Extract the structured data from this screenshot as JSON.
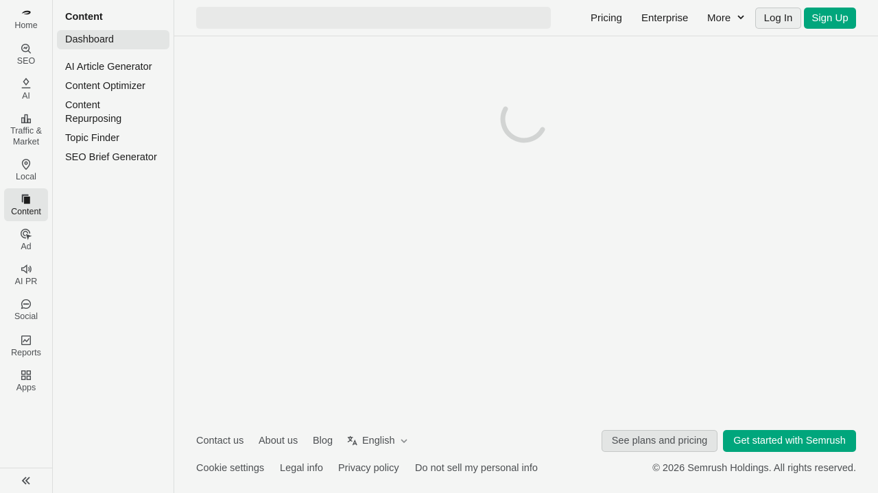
{
  "rail": {
    "items": [
      {
        "label": "Home",
        "icon": "semrush-logo-icon"
      },
      {
        "label": "SEO",
        "icon": "seo-magnifier-icon"
      },
      {
        "label": "AI",
        "icon": "ai-sparkle-icon"
      },
      {
        "label": "Traffic & Market",
        "icon": "bar-chart-icon"
      },
      {
        "label": "Local",
        "icon": "map-pin-icon"
      },
      {
        "label": "Content",
        "icon": "documents-icon"
      },
      {
        "label": "Ad",
        "icon": "ad-target-icon"
      },
      {
        "label": "AI PR",
        "icon": "megaphone-icon"
      },
      {
        "label": "Social",
        "icon": "chat-bubble-icon"
      },
      {
        "label": "Reports",
        "icon": "report-chart-icon"
      },
      {
        "label": "Apps",
        "icon": "apps-grid-icon"
      }
    ],
    "active": "Content",
    "collapse_icon": "double-chevron-left-icon"
  },
  "subnav": {
    "title": "Content",
    "items": [
      {
        "label": "Dashboard"
      },
      {
        "label": "AI Article Generator"
      },
      {
        "label": "Content Optimizer"
      },
      {
        "label": "Content Repurposing"
      },
      {
        "label": "Topic Finder"
      },
      {
        "label": "SEO Brief Generator"
      }
    ],
    "active": "Dashboard"
  },
  "header": {
    "search_placeholder": "",
    "links": {
      "pricing": "Pricing",
      "enterprise": "Enterprise",
      "more": "More"
    },
    "login": "Log In",
    "signup": "Sign Up"
  },
  "footer": {
    "links": {
      "contact": "Contact us",
      "about": "About us",
      "blog": "Blog"
    },
    "language": "English",
    "plans_button": "See plans and pricing",
    "start_button": "Get started with Semrush",
    "legal": {
      "cookie": "Cookie settings",
      "legal_info": "Legal info",
      "privacy": "Privacy policy",
      "do_not_sell": "Do not sell my personal info"
    },
    "copyright": "© 2026 Semrush Holdings. All rights reserved."
  },
  "colors": {
    "accent": "#00a67c",
    "background": "#f4f5f4",
    "active_bg": "#e3e5e4",
    "spinner": "#d2d4d3"
  }
}
